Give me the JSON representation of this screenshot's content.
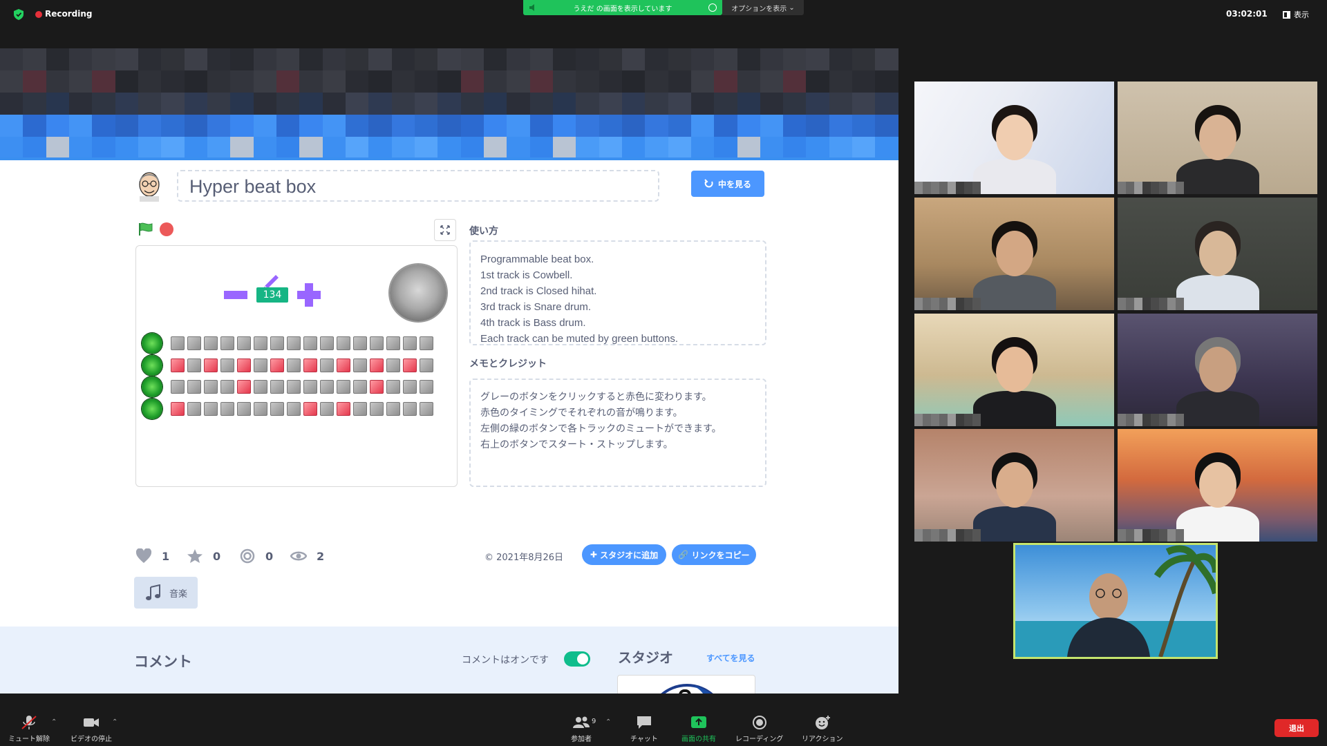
{
  "zoom": {
    "recording_label": "Recording",
    "share_banner": "うえだ の画面を表示しています",
    "options_label": "オプションを表示",
    "meeting_time": "03:02:01",
    "view_label": "表示",
    "participants_count": "9",
    "toolbar": {
      "mute": "ミュート解除",
      "video": "ビデオの停止",
      "participants": "参加者",
      "chat": "チャット",
      "share": "画面の共有",
      "recording": "レコーディング",
      "reaction": "リアクション",
      "leave": "退出"
    },
    "colors": {
      "share_green": "#1fc35b",
      "leave_red": "#e02828",
      "active_speaker": "#c5e56e"
    }
  },
  "project": {
    "title": "Hyper beat box",
    "see_inside": "中を見る",
    "tempo": "134",
    "tracks": [
      [
        0,
        0,
        0,
        0,
        0,
        0,
        0,
        0,
        0,
        0,
        0,
        0,
        0,
        0,
        0,
        0
      ],
      [
        1,
        0,
        1,
        0,
        1,
        0,
        1,
        0,
        1,
        0,
        1,
        0,
        1,
        0,
        1,
        0
      ],
      [
        0,
        0,
        0,
        0,
        1,
        0,
        0,
        0,
        0,
        0,
        0,
        0,
        1,
        0,
        0,
        0
      ],
      [
        1,
        0,
        0,
        0,
        0,
        0,
        0,
        0,
        1,
        0,
        1,
        0,
        0,
        0,
        0,
        0
      ]
    ],
    "instructions_label": "使い方",
    "instructions": [
      "Programmable beat box.",
      "1st track is Cowbell.",
      "2nd track is Closed hihat.",
      "3rd track is Snare drum.",
      "4th track is Bass drum.",
      "Each track can be muted by green buttons."
    ],
    "notes_label": "メモとクレジット",
    "notes": [
      "グレーのボタンをクリックすると赤色に変わります。",
      "赤色のタイミングでそれぞれの音が鳴ります。",
      "左側の緑のボタンで各トラックのミュートができます。",
      "右上のボタンでスタート・ストップします。"
    ],
    "stats": {
      "loves": "1",
      "favorites": "0",
      "remixes": "0",
      "views": "2"
    },
    "date": "© 2021年8月26日",
    "add_to_studio": "スタジオに追加",
    "copy_link": "リンクをコピー",
    "tag": "音楽",
    "comments_title": "コメント",
    "comments_on": "コメントはオンです",
    "studios_title": "スタジオ",
    "see_all": "すべてを見る",
    "colors": {
      "accent": "#4c97ff",
      "text": "#575e75",
      "tempo": "#16b584",
      "purple": "#9966ff"
    }
  }
}
